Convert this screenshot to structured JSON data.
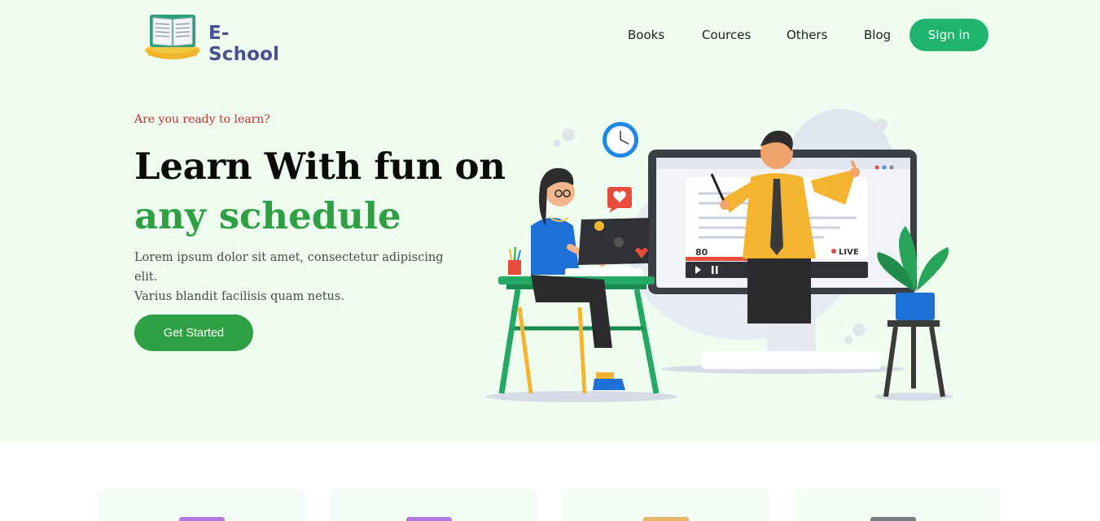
{
  "brand": {
    "name": "E- School"
  },
  "nav": {
    "books": "Books",
    "cources": "Cources",
    "others": "Others",
    "blog": "Blog",
    "signin": "SIgn in"
  },
  "hero": {
    "eyebrow": "Are you ready to learn?",
    "title_line1": "Learn With fun on",
    "title_line2": "any schedule",
    "description_line1": "Lorem ipsum dolor sit amet, consectetur adipiscing elit.",
    "description_line2": "Varius blandit facilisis quam netus.",
    "cta": "Get Started"
  },
  "illustration": {
    "viewer_count": "80",
    "live_label": "LIVE"
  },
  "colors": {
    "hero_bg": "#effdf1",
    "accent_green": "#2ea043",
    "signin_green": "#1fb46c",
    "brand_text": "#4a4f8f",
    "eyebrow_red": "#d02b2b"
  },
  "cards": [
    {
      "icon": "book-icon",
      "color": "#b07be0"
    },
    {
      "icon": "book-icon",
      "color": "#b07be0"
    },
    {
      "icon": "book-icon",
      "color": "#e7b66a"
    },
    {
      "icon": "book-icon",
      "color": "#7a7f86"
    }
  ]
}
